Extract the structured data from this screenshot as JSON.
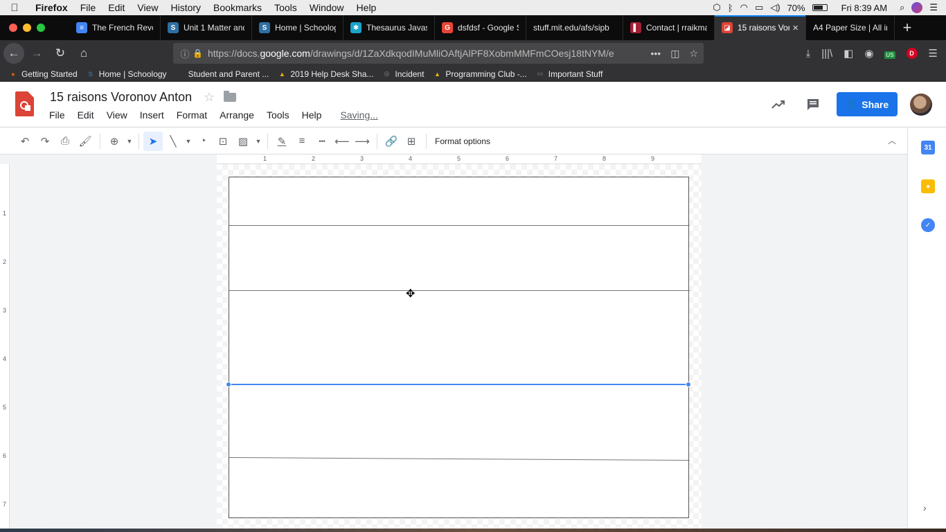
{
  "mac_menu": {
    "app": "Firefox",
    "items": [
      "File",
      "Edit",
      "View",
      "History",
      "Bookmarks",
      "Tools",
      "Window",
      "Help"
    ],
    "battery": "70%",
    "clock": "Fri 8:39 AM"
  },
  "tabs": [
    {
      "title": "The French Revo",
      "fav_color": "#4285f4",
      "fav_glyph": "≡"
    },
    {
      "title": "Unit 1 Matter and",
      "fav_color": "#2f6fa3",
      "fav_glyph": "S"
    },
    {
      "title": "Home | Schoolog",
      "fav_color": "#2f6fa3",
      "fav_glyph": "S"
    },
    {
      "title": "Thesaurus Javas",
      "fav_color": "#1aa3c9",
      "fav_glyph": "✱"
    },
    {
      "title": "dsfdsf - Google S",
      "fav_color": "#ea4335",
      "fav_glyph": "G"
    },
    {
      "title": "stuff.mit.edu/afs/sipb",
      "fav_color": "",
      "fav_glyph": ""
    },
    {
      "title": "Contact | rraikma",
      "fav_color": "#a31f34",
      "fav_glyph": "▌"
    },
    {
      "title": "15 raisons Vor",
      "fav_color": "#db4437",
      "fav_glyph": "◪",
      "active": true
    },
    {
      "title": "A4 Paper Size | All inf",
      "fav_color": "",
      "fav_glyph": ""
    }
  ],
  "address": {
    "prefix": "https://docs.",
    "domain": "google.com",
    "path": "/drawings/d/1ZaXdkqodIMuMliOAftjAlPF8XobmMMFmCOesj18tNYM/e"
  },
  "bookmarks": [
    {
      "label": "Getting Started",
      "color": "#e66000",
      "glyph": "●"
    },
    {
      "label": "Home | Schoology",
      "color": "#2f6fa3",
      "glyph": "S"
    },
    {
      "label": "Student and Parent ...",
      "color": "#333",
      "glyph": "P"
    },
    {
      "label": "2019 Help Desk Sha...",
      "color": "#f4b400",
      "glyph": "▲"
    },
    {
      "label": "Incident",
      "color": "#888",
      "glyph": "◎"
    },
    {
      "label": "Programming Club -...",
      "color": "#f4b400",
      "glyph": "▲"
    },
    {
      "label": "Important Stuff",
      "color": "#888",
      "glyph": "▭"
    }
  ],
  "doc": {
    "title": "15 raisons Voronov Anton",
    "menu": [
      "File",
      "Edit",
      "View",
      "Insert",
      "Format",
      "Arrange",
      "Tools",
      "Help"
    ],
    "saving_status": "Saving...",
    "share_label": "Share"
  },
  "toolbar": {
    "format_options_label": "Format options"
  },
  "ruler": {
    "horizontal": [
      "1",
      "2",
      "3",
      "4",
      "5",
      "6",
      "7",
      "8",
      "9"
    ],
    "vertical": [
      "1",
      "2",
      "3",
      "4",
      "5",
      "6",
      "7"
    ]
  },
  "icons": {
    "undo": "undo-icon",
    "redo": "redo-icon",
    "print": "print-icon",
    "paint_format": "paint-format-icon",
    "zoom": "zoom-icon",
    "select": "select-icon",
    "line": "line-icon",
    "shape": "shape-icon",
    "textbox": "textbox-icon",
    "image": "image-icon",
    "border_color": "border-color-icon",
    "border_weight": "border-weight-icon",
    "border_dash": "border-dash-icon",
    "line_start": "line-start-icon",
    "line_end": "line-end-icon",
    "link": "link-icon",
    "comment": "add-comment-icon"
  },
  "colors": {
    "share_blue": "#1a73e8",
    "selection_blue": "#4285f4",
    "drawings_red": "#db4437"
  }
}
